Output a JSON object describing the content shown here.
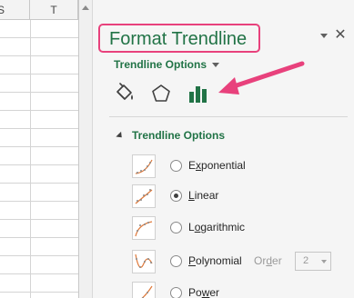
{
  "spreadsheet": {
    "column_headers": [
      "S",
      "T"
    ]
  },
  "pane": {
    "title": "Format Trendline",
    "options_dropdown_label": "Trendline Options",
    "section_header": "Trendline Options",
    "tabs": [
      {
        "name": "fill-line",
        "icon": "paint-bucket-icon"
      },
      {
        "name": "effects",
        "icon": "pentagon-icon"
      },
      {
        "name": "trendline-options",
        "icon": "bar-chart-icon",
        "selected": true
      }
    ],
    "trendline_types": [
      {
        "label": "Exponential",
        "access_key": "x",
        "selected": false
      },
      {
        "label": "Linear",
        "access_key": "L",
        "selected": true
      },
      {
        "label": "Logarithmic",
        "access_key": "o",
        "selected": false
      },
      {
        "label": "Polynomial",
        "access_key": "P",
        "selected": false
      },
      {
        "label": "Power",
        "access_key": "w",
        "selected": false
      }
    ],
    "order": {
      "label": "Order",
      "value": "2"
    }
  },
  "colors": {
    "accent_green": "#217346",
    "highlight_pink": "#e8417c",
    "pane_background": "#f5f5f5"
  }
}
